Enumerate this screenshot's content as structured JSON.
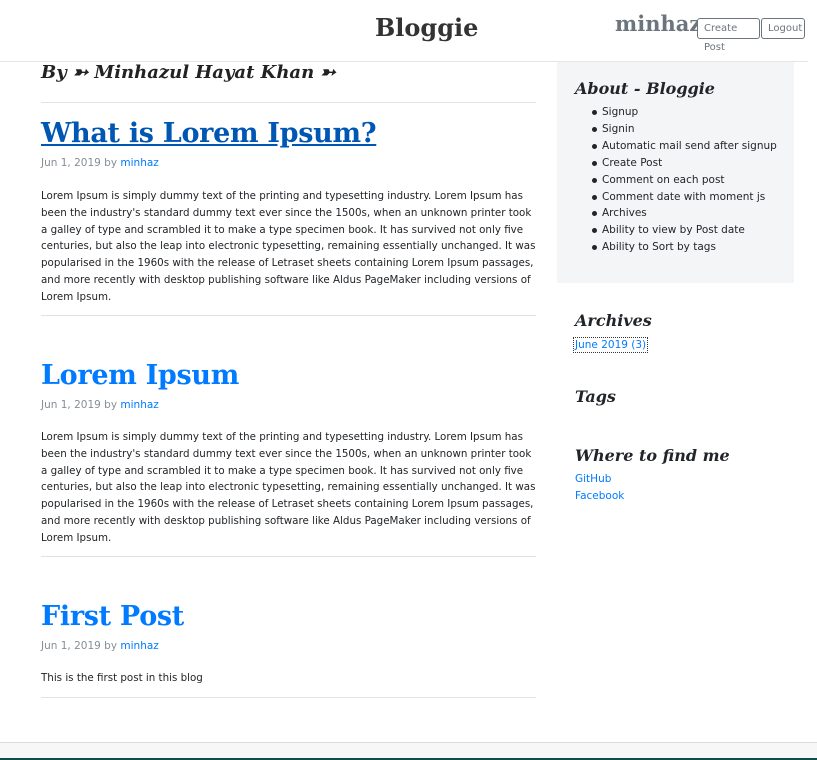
{
  "header": {
    "brand": "Bloggie",
    "username": "minhaz",
    "create_post_label": "Create Post",
    "logout_label": "Logout"
  },
  "byline": "By ➳ Minhazul Hayat Khan ➳",
  "posts": [
    {
      "title": "What is Lorem Ipsum?",
      "date": "Jun 1, 2019",
      "by": "by",
      "author": "minhaz",
      "excerpt": "Lorem Ipsum is simply dummy text of the printing and typesetting industry. Lorem Ipsum has been the industry's standard dummy text ever since the 1500s, when an unknown printer took a galley of type and scrambled it to make a type specimen book. It has survived not only five centuries, but also the leap into electronic typesetting, remaining essentially unchanged. It was popularised in the 1960s with the release of Letraset sheets containing Lorem Ipsum passages, and more recently with desktop publishing software like Aldus PageMaker including versions of Lorem Ipsum."
    },
    {
      "title": "Lorem Ipsum",
      "date": "Jun 1, 2019",
      "by": "by",
      "author": "minhaz",
      "excerpt": "Lorem Ipsum is simply dummy text of the printing and typesetting industry. Lorem Ipsum has been the industry's standard dummy text ever since the 1500s, when an unknown printer took a galley of type and scrambled it to make a type specimen book. It has survived not only five centuries, but also the leap into electronic typesetting, remaining essentially unchanged. It was popularised in the 1960s with the release of Letraset sheets containing Lorem Ipsum passages, and more recently with desktop publishing software like Aldus PageMaker including versions of Lorem Ipsum."
    },
    {
      "title": "First Post",
      "date": "Jun 1, 2019",
      "by": "by",
      "author": "minhaz",
      "excerpt": "This is the first post in this blog"
    }
  ],
  "sidebar": {
    "about_title": "About - Bloggie",
    "about_items": [
      "Signup",
      "Signin",
      "Automatic mail send after signup",
      "Create Post",
      "Comment on each post",
      "Comment date with moment js",
      "Archives",
      "Ability to view by Post date",
      "Ability to Sort by tags"
    ],
    "archives_title": "Archives",
    "archive_link": "June 2019 (3)",
    "tags_title": "Tags",
    "find_title": "Where to find me",
    "find_links": [
      "GitHub",
      "Facebook"
    ]
  }
}
